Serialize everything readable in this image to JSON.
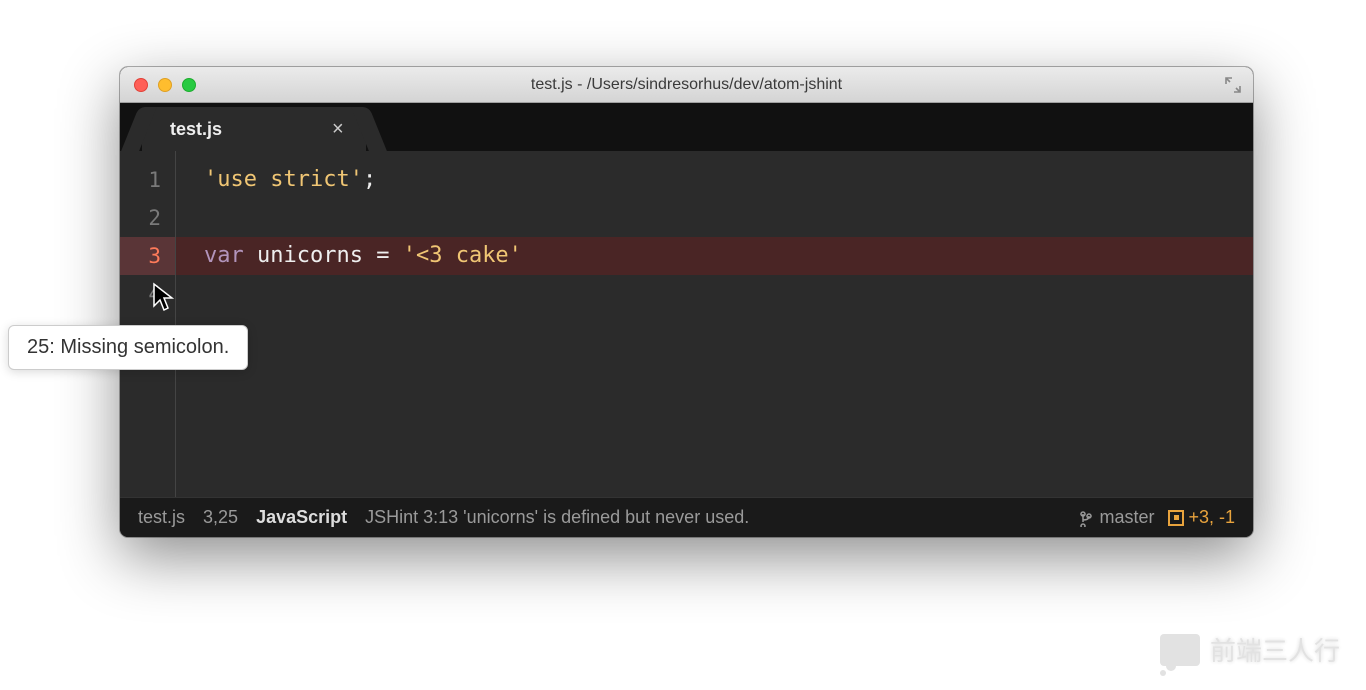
{
  "window": {
    "title": "test.js - /Users/sindresorhus/dev/atom-jshint"
  },
  "tab": {
    "title": "test.js",
    "close_glyph": "×"
  },
  "editor": {
    "lines": [
      {
        "num": "1",
        "error": false,
        "highlighted": false,
        "tokens": [
          {
            "cls": "tok-string",
            "text": "'use strict'"
          },
          {
            "cls": "tok-semi",
            "text": ";"
          }
        ]
      },
      {
        "num": "2",
        "error": false,
        "highlighted": false,
        "tokens": []
      },
      {
        "num": "3",
        "error": true,
        "highlighted": true,
        "tokens": [
          {
            "cls": "tok-keyword",
            "text": "var"
          },
          {
            "cls": "",
            "text": " "
          },
          {
            "cls": "tok-var",
            "text": "unicorns"
          },
          {
            "cls": "",
            "text": " "
          },
          {
            "cls": "tok-op",
            "text": "="
          },
          {
            "cls": "",
            "text": " "
          },
          {
            "cls": "tok-string",
            "text": "'<3 cake'"
          }
        ]
      },
      {
        "num": "4",
        "error": false,
        "highlighted": false,
        "tokens": []
      }
    ]
  },
  "tooltip": {
    "text": "25: Missing semicolon."
  },
  "status": {
    "filename": "test.js",
    "cursor_pos": "3,25",
    "language": "JavaScript",
    "lint_message": "JSHint 3:13 'unicorns' is defined but never used.",
    "git_branch": "master",
    "git_diff": "+3, -1"
  },
  "watermark": {
    "text": "前端三人行"
  }
}
